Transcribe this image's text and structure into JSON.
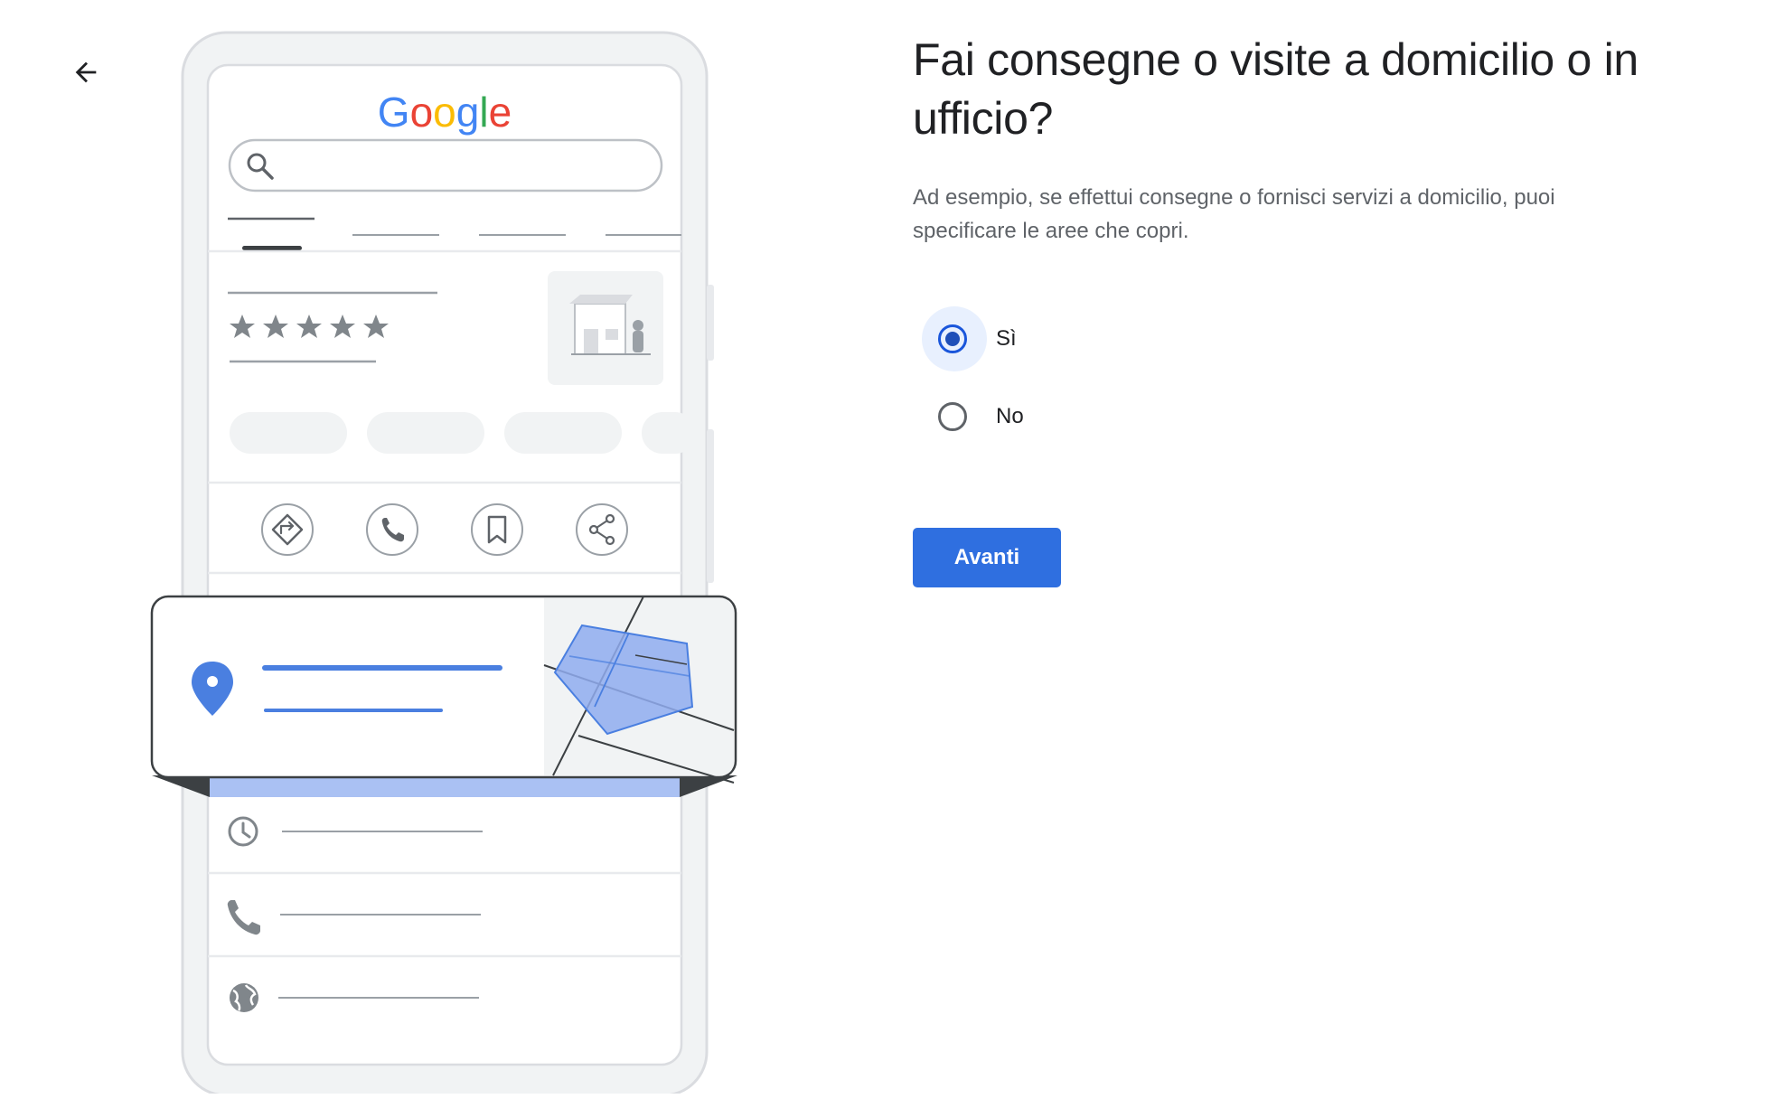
{
  "nav": {
    "back_icon": "arrow-back-icon"
  },
  "illustration": {
    "logo_text": "Google",
    "logo_colors": [
      "#4285F4",
      "#EA4335",
      "#FBBC05",
      "#4285F4",
      "#34A853",
      "#EA4335"
    ],
    "rating_stars": 5,
    "action_icons": [
      "directions-icon",
      "phone-icon",
      "bookmark-icon",
      "share-icon"
    ],
    "detail_icons": [
      "clock-icon",
      "phone-icon",
      "globe-icon"
    ],
    "accent_color": "#4a7fe0",
    "area_fill": "#a7bdf5"
  },
  "question": {
    "title": "Fai consegne o visite a domicilio o in ufficio?",
    "description": "Ad esempio, se effettui consegne o fornisci servizi a domicilio, puoi specificare le aree che copri."
  },
  "options": [
    {
      "label": "Sì",
      "selected": true
    },
    {
      "label": "No",
      "selected": false
    }
  ],
  "actions": {
    "next_label": "Avanti",
    "primary_color": "#2f6fe0"
  }
}
